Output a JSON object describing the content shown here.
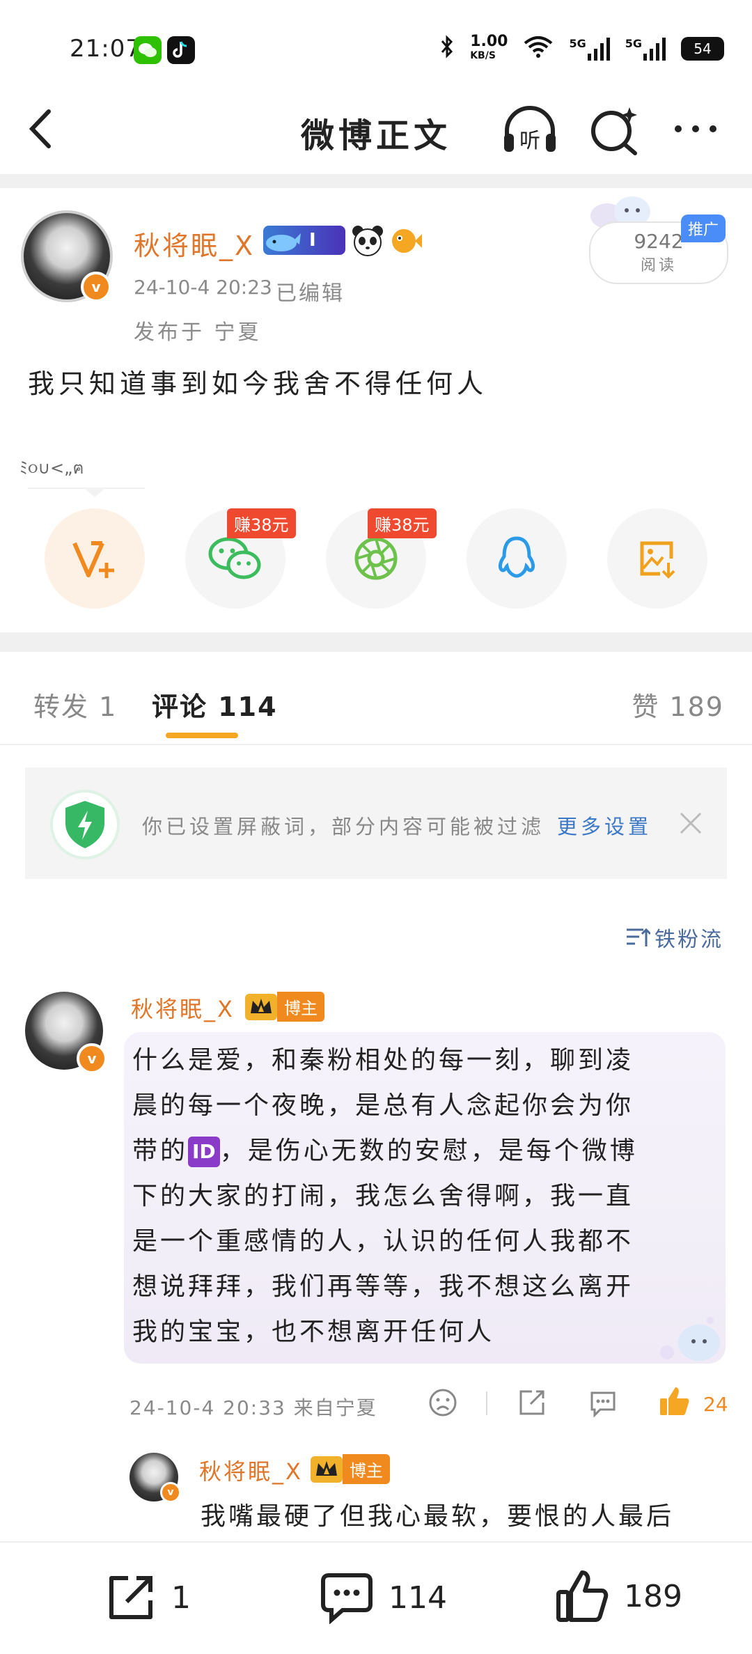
{
  "status": {
    "time": "21:07",
    "net_speed_top": "1.00",
    "net_speed_bottom": "KB/S",
    "sig1": "5G",
    "sig2": "5G",
    "battery": "54"
  },
  "nav": {
    "title": "微博正文"
  },
  "post": {
    "username": "秋将眠_X",
    "rank": "I",
    "datetime": "24-10-4 20:23",
    "edited": "已编辑",
    "location": "发布于 宁夏",
    "read_count": "9242",
    "read_label": "阅读",
    "promo_badge": "推广",
    "text": "我只知道事到如今我舍不得任何人",
    "doodle_text": "ﾐ૦∪<„ฅ"
  },
  "share": {
    "earn1": "赚38元",
    "earn2": "赚38元"
  },
  "tabs": {
    "repost": "转发 1",
    "comment": "评论 114",
    "likes": "赞 189"
  },
  "notice": {
    "text": "你已设置屏蔽词，部分内容可能被过滤",
    "link": "更多设置"
  },
  "sort": {
    "label": "铁粉流"
  },
  "comment": {
    "username": "秋将眠_X",
    "badge": "博主",
    "line1": "什么是爱，和秦粉相处的每一刻，聊到凌",
    "line2": "晨的每一个夜晚，是总有人念起你会为你",
    "line3_pre": "带的",
    "id_tag": "ID",
    "line3_post": "，是伤心无数的安慰，是每个微博",
    "line4": "下的大家的打闹，我怎么舍得啊，我一直",
    "line5": "是一个重感情的人，认识的任何人我都不",
    "line6": "想说拜拜，我们再等等，我不想这么离开",
    "line7": "我的宝宝，也不想离开任何人",
    "meta": "24-10-4 20:33  来自宁夏",
    "like_count": "24"
  },
  "reply": {
    "username": "秋将眠_X",
    "badge": "博主",
    "text": "我嘴最硬了但我心最软，要恨的人最后"
  },
  "bottom": {
    "repost_count": "1",
    "comment_count": "114",
    "like_count": "189"
  }
}
